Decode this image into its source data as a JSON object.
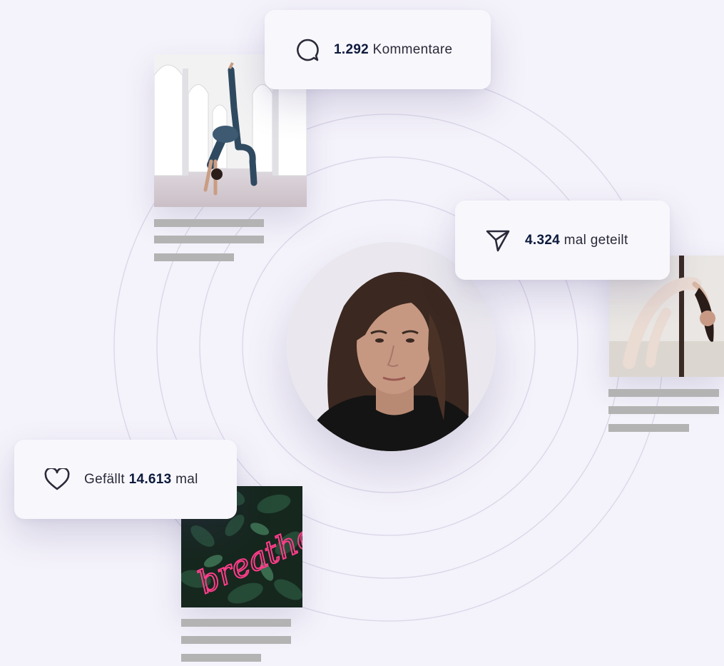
{
  "comments": {
    "count": "1.292",
    "label": "Kommentare",
    "icon": "comment-bubble-icon"
  },
  "shares": {
    "count": "4.324",
    "label": "mal geteilt",
    "icon": "paper-plane-icon"
  },
  "likes": {
    "prefix": "Gefällt",
    "count": "14.613",
    "suffix": "mal",
    "icon": "heart-icon"
  },
  "posts": [
    {
      "name": "yoga-backbend-photo"
    },
    {
      "name": "dancer-backbend-photo"
    },
    {
      "name": "breathe-neon-photo",
      "neon_text": "breathe"
    }
  ],
  "profile": {
    "name": "profile-avatar"
  },
  "colors": {
    "background": "#f4f2fa",
    "card": "#f8f7fc",
    "count_text": "#0c1a3c",
    "placeholder_bar": "#b3b3b3",
    "ring": "#dcd8ea",
    "neon": "#ff3d8a"
  }
}
